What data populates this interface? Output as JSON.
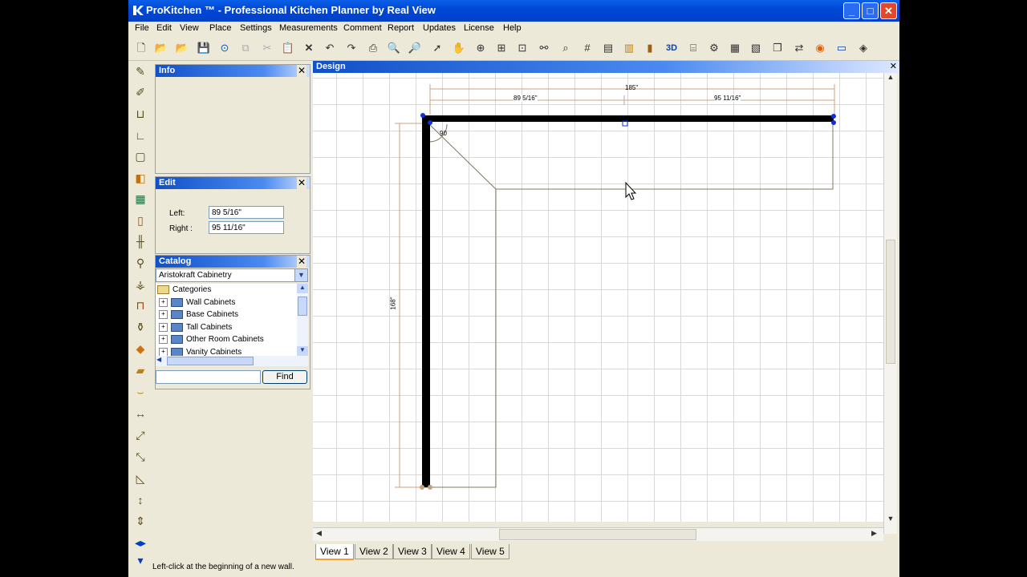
{
  "window": {
    "title": "ProKitchen ™ - Professional Kitchen Planner by Real View",
    "min_label": "_",
    "max_label": "□",
    "close_label": "✕"
  },
  "menu": [
    "File",
    "Edit",
    "View",
    "Place",
    "Settings",
    "Measurements",
    "Comment",
    "Report",
    "Updates",
    "License",
    "Help"
  ],
  "panels": {
    "info": {
      "title": "Info"
    },
    "edit": {
      "title": "Edit",
      "left_label": "Left:",
      "left_value": "89 5/16\"",
      "right_label": "Right :",
      "right_value": "95 11/16\""
    },
    "catalog": {
      "title": "Catalog",
      "selected": "Aristokraft Cabinetry",
      "root": "Categories",
      "items": [
        "Wall Cabinets",
        "Base Cabinets",
        "Tall Cabinets",
        "Other Room Cabinets",
        "Vanity Cabinets"
      ],
      "search_value": "",
      "find_label": "Find"
    }
  },
  "design": {
    "title": "Design",
    "dims": {
      "total_top": "185\"",
      "left_segment": "89 5/16\"",
      "right_segment": "95 11/16\"",
      "vertical": "168\"",
      "angle": "90"
    },
    "tabs": [
      "View 1",
      "View 2",
      "View 3",
      "View 4",
      "View 5"
    ],
    "active_tab": "View 1"
  },
  "status": "Left-click at the beginning of a new wall."
}
